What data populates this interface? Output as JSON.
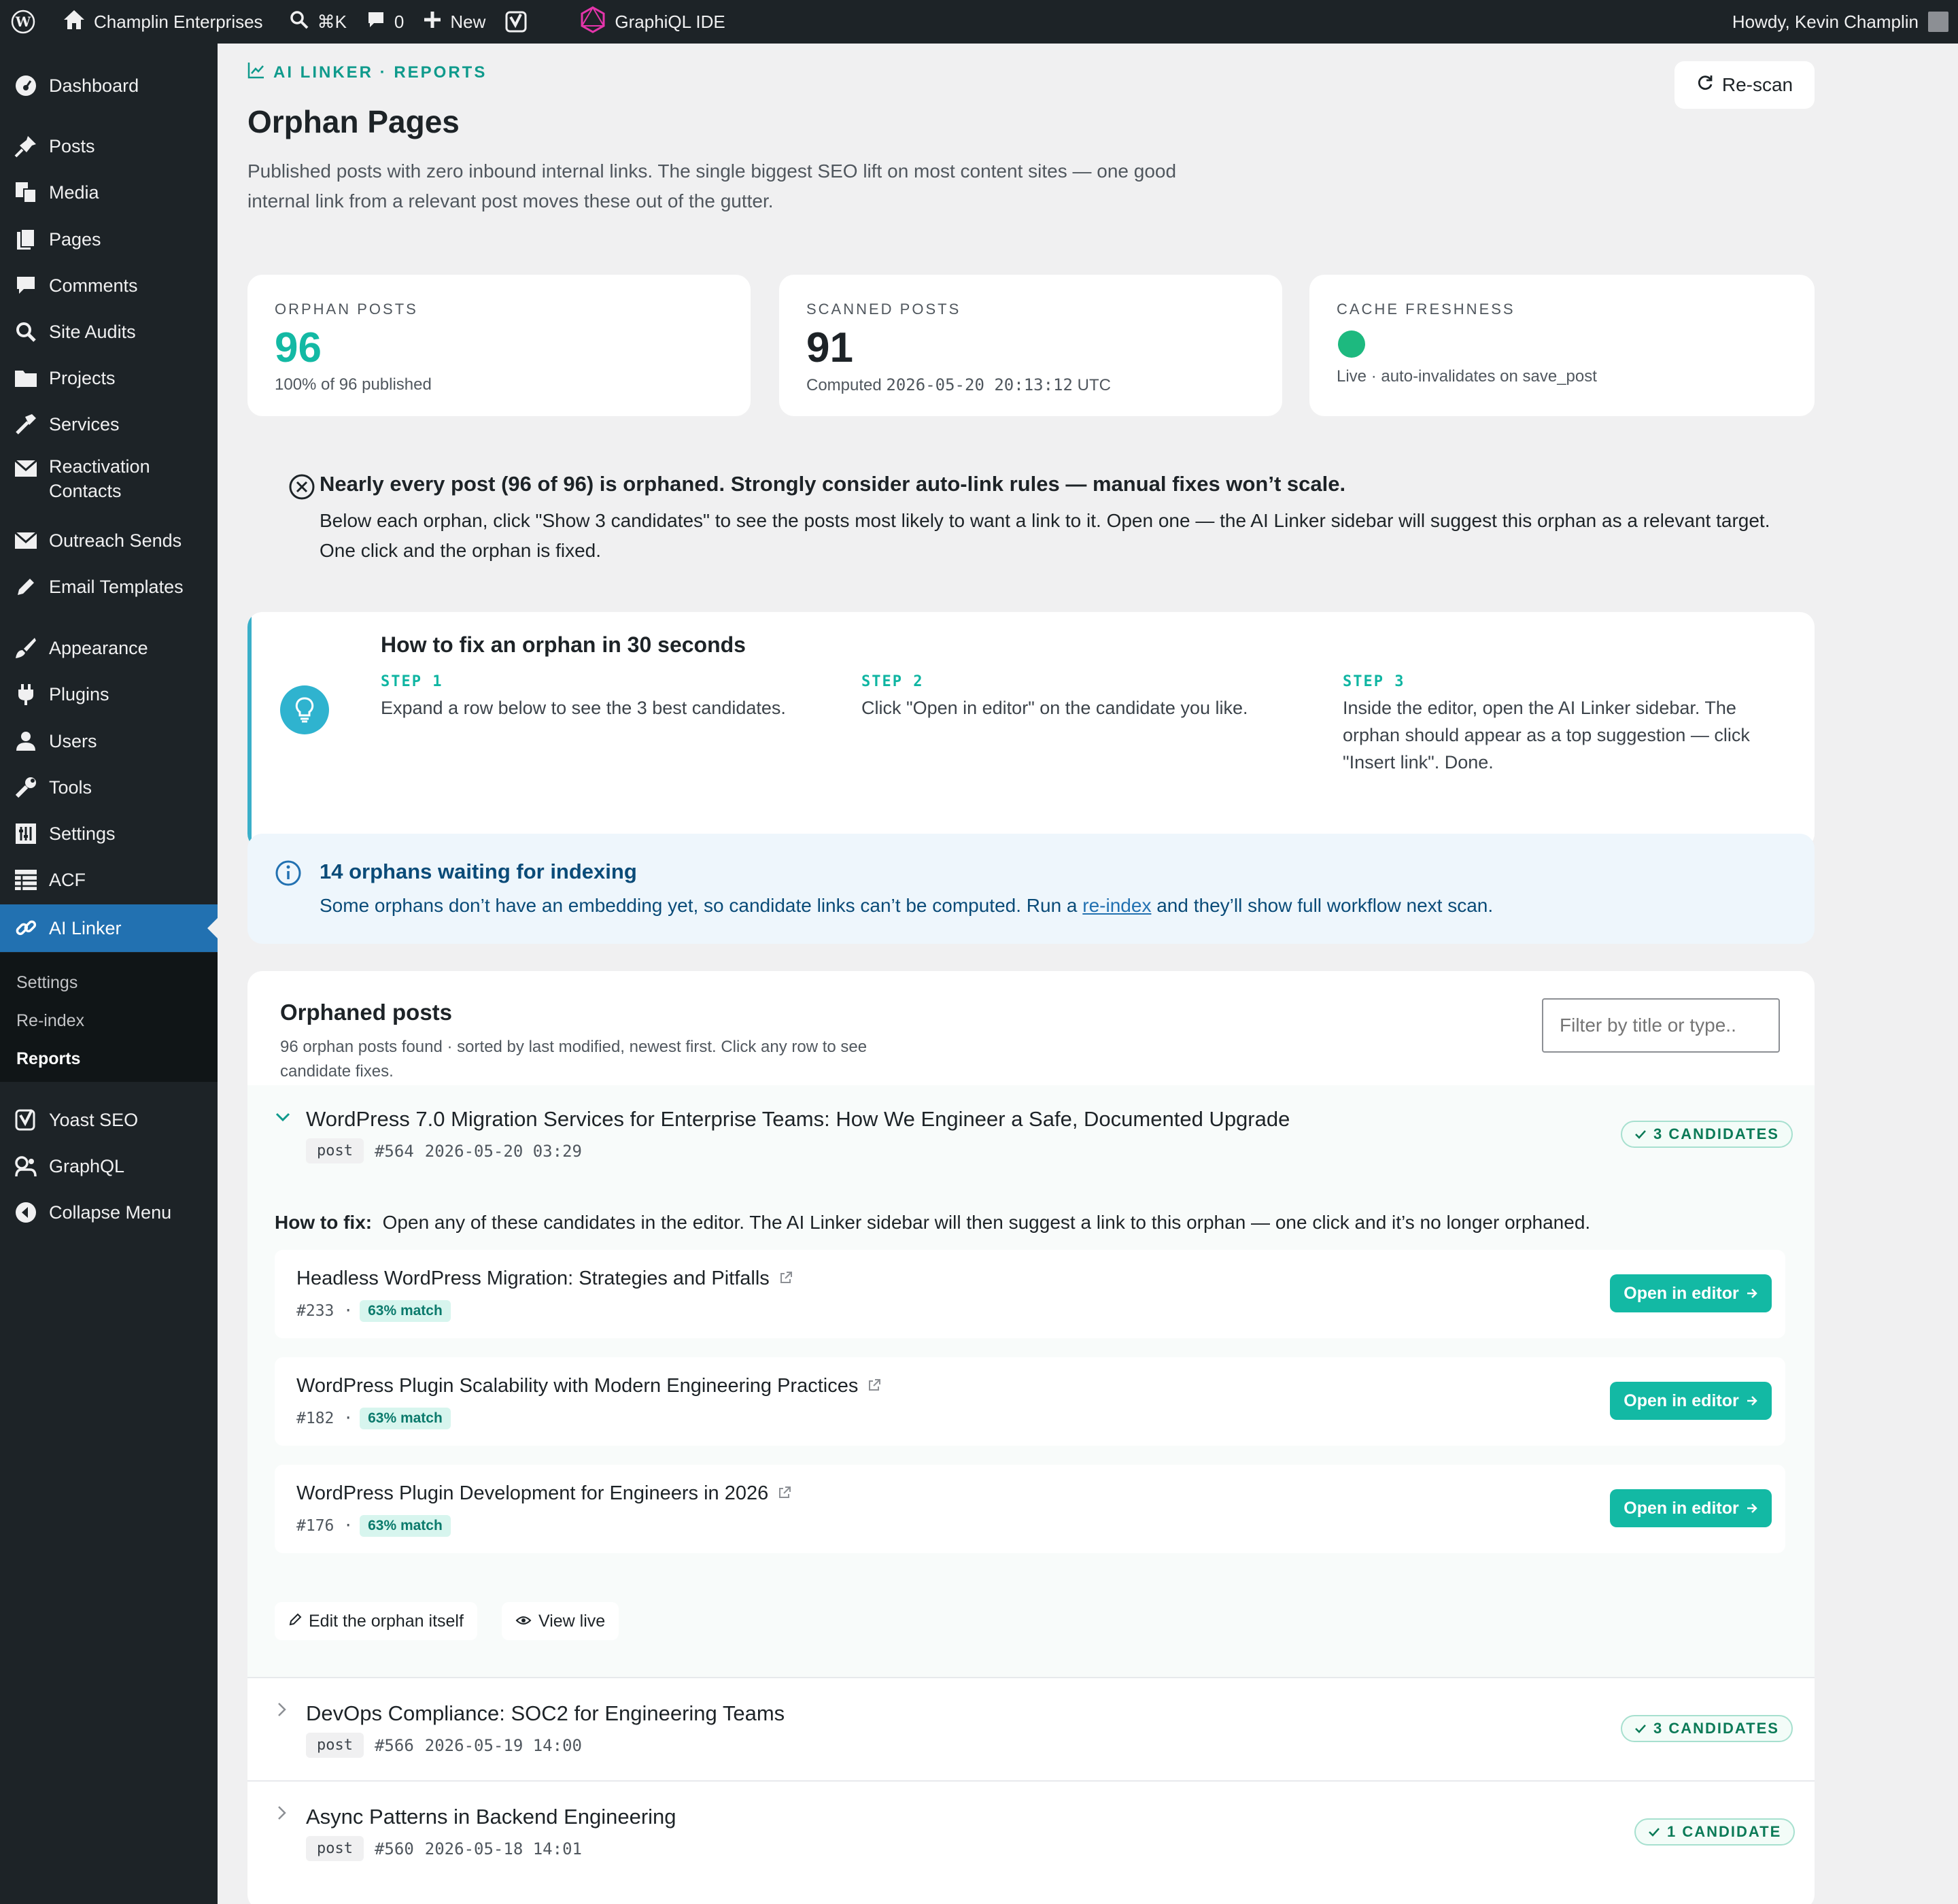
{
  "admin_bar": {
    "site_name": "Champlin Enterprises",
    "search_shortcut": "⌘K",
    "comments_count": "0",
    "new_label": "New",
    "graphiql_label": "GraphiQL IDE",
    "howdy": "Howdy, Kevin Champlin"
  },
  "sidebar": {
    "items": [
      {
        "label": "Dashboard",
        "icon": "dashboard-icon"
      },
      {
        "label": "Posts",
        "icon": "pin-icon"
      },
      {
        "label": "Media",
        "icon": "media-icon"
      },
      {
        "label": "Pages",
        "icon": "pages-icon"
      },
      {
        "label": "Comments",
        "icon": "comment-icon"
      },
      {
        "label": "Site Audits",
        "icon": "search-icon"
      },
      {
        "label": "Projects",
        "icon": "folder-icon"
      },
      {
        "label": "Services",
        "icon": "hammer-icon"
      },
      {
        "label": "Reactivation Contacts",
        "label_line1": "Reactivation",
        "label_line2": "Contacts",
        "icon": "mail-icon"
      },
      {
        "label": "Outreach Sends",
        "icon": "mail-icon"
      },
      {
        "label": "Email Templates",
        "icon": "pencil-icon"
      },
      {
        "label": "Appearance",
        "icon": "brush-icon"
      },
      {
        "label": "Plugins",
        "icon": "plugin-icon"
      },
      {
        "label": "Users",
        "icon": "user-icon"
      },
      {
        "label": "Tools",
        "icon": "wrench-icon"
      },
      {
        "label": "Settings",
        "icon": "settings-icon"
      },
      {
        "label": "ACF",
        "icon": "acf-icon"
      },
      {
        "label": "AI Linker",
        "icon": "link-icon"
      },
      {
        "label": "Yoast SEO",
        "icon": "yoast-icon"
      },
      {
        "label": "GraphQL",
        "icon": "graphql-icon"
      },
      {
        "label": "Collapse Menu",
        "icon": "collapse-icon"
      }
    ],
    "submenu": [
      "Settings",
      "Re-index",
      "Reports"
    ]
  },
  "header": {
    "kicker": "AI LINKER · REPORTS",
    "title": "Orphan Pages",
    "description": "Published posts with zero inbound internal links. The single biggest SEO lift on most content sites — one good internal link from a relevant post moves these out of the gutter.",
    "rescan_label": "Re-scan"
  },
  "stats": [
    {
      "label": "ORPHAN POSTS",
      "value": "96",
      "sub": "100% of 96 published"
    },
    {
      "label": "SCANNED POSTS",
      "value": "91",
      "sub_prefix": "Computed ",
      "sub_mono": "2026-05-20 20:13:12",
      "sub_suffix": " UTC"
    },
    {
      "label": "CACHE FRESHNESS",
      "status_color": "#1db97f",
      "sub": "Live · auto-invalidates on save_post"
    }
  ],
  "warning": {
    "title": "Nearly every post (96 of 96) is orphaned. Strongly consider auto-link rules — manual fixes won’t scale.",
    "body": "Below each orphan, click \"Show 3 candidates\" to see the posts most likely to want a link to it. Open one — the AI Linker sidebar will suggest this orphan as a relevant target. One click and the orphan is fixed."
  },
  "howto": {
    "title": "How to fix an orphan in 30 seconds",
    "steps": [
      {
        "label": "STEP 1",
        "text": "Expand a row below to see the 3 best candidates."
      },
      {
        "label": "STEP 2",
        "text": "Click \"Open in editor\" on the candidate you like."
      },
      {
        "label": "STEP 3",
        "text": "Inside the editor, open the AI Linker sidebar. The orphan should appear as a top suggestion — click \"Insert link\". Done."
      }
    ]
  },
  "info": {
    "title": "14 orphans waiting for indexing",
    "text_before": "Some orphans don’t have an embedding yet, so candidate links can’t be computed. Run a ",
    "link": "re-index",
    "text_after": " and they’ll show full workflow next scan."
  },
  "orphans": {
    "title": "Orphaned posts",
    "subtitle": "96 orphan posts found · sorted by last modified, newest first. Click any row to see candidate fixes.",
    "filter_placeholder": "Filter by title or type..",
    "rows": [
      {
        "title": "WordPress 7.0 Migration Services for Enterprise Teams: How We Engineer a Safe, Documented Upgrade",
        "type": "post",
        "id": "#564",
        "date": "2026-05-20 03:29",
        "badge": "3 CANDIDATES",
        "expanded": true
      },
      {
        "title": "DevOps Compliance: SOC2 for Engineering Teams",
        "type": "post",
        "id": "#566",
        "date": "2026-05-19 14:00",
        "badge": "3 CANDIDATES",
        "expanded": false
      },
      {
        "title": "Async Patterns in Backend Engineering",
        "type": "post",
        "id": "#560",
        "date": "2026-05-18 14:01",
        "badge": "1 CANDIDATE",
        "expanded": false
      }
    ],
    "how_to_fix_label": "How to fix:",
    "how_to_fix_text": "Open any of these candidates in the editor. The AI Linker sidebar will then suggest a link to this orphan — one click and it’s no longer orphaned.",
    "candidates": [
      {
        "title": "Headless WordPress Migration: Strategies and Pitfalls",
        "id": "#233 ·",
        "match": "63% match",
        "button": "Open in editor"
      },
      {
        "title": "WordPress Plugin Scalability with Modern Engineering Practices",
        "id": "#182 ·",
        "match": "63% match",
        "button": "Open in editor"
      },
      {
        "title": "WordPress Plugin Development for Engineers in 2026",
        "id": "#176 ·",
        "match": "63% match",
        "button": "Open in editor"
      }
    ],
    "edit_orphan_label": "Edit the orphan itself",
    "view_live_label": "View live"
  },
  "colors": {
    "accent": "#13b9a4",
    "wp_blue": "#2271b1",
    "admin_dark": "#1d2327"
  }
}
